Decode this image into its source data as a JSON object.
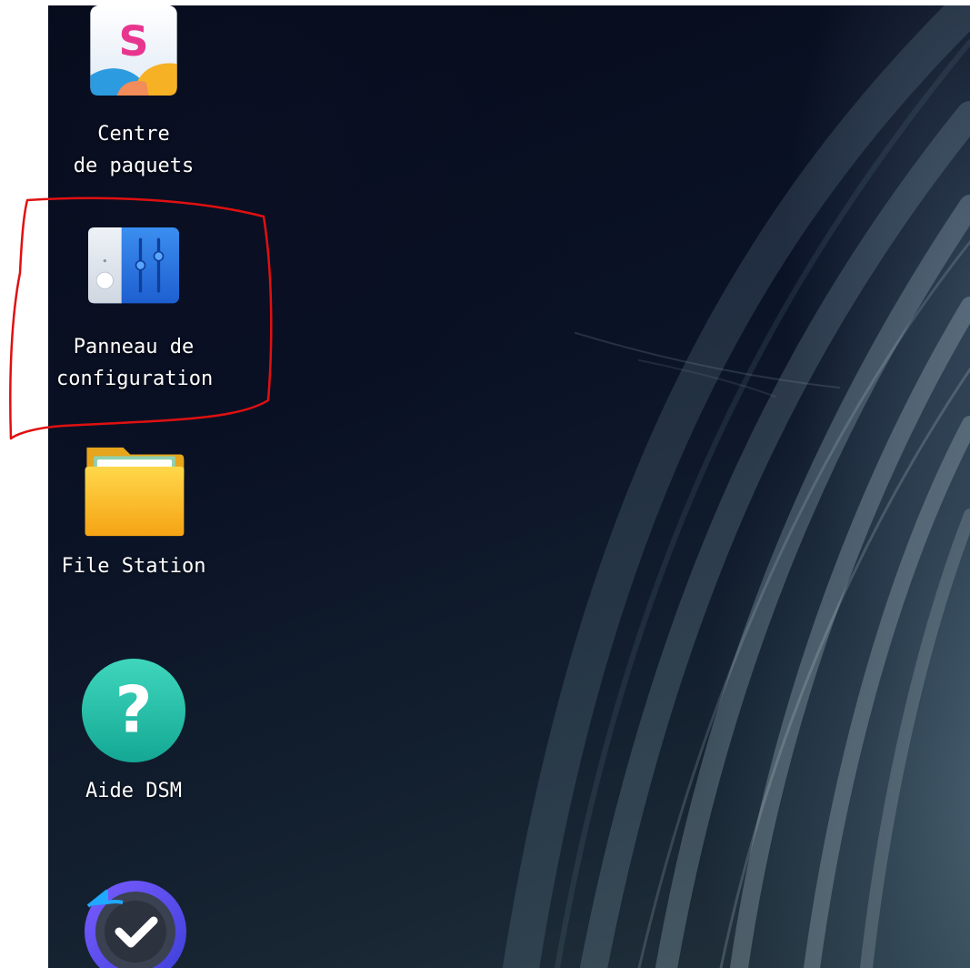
{
  "desktop": {
    "icons": [
      {
        "label": "Centre\nde paquets",
        "icon": "package-center-icon"
      },
      {
        "label": "Panneau de\nconfiguration",
        "icon": "control-panel-icon",
        "highlighted": true
      },
      {
        "label": "File Station",
        "icon": "file-station-folder-icon"
      },
      {
        "label": "Aide DSM",
        "icon": "help-question-icon"
      },
      {
        "label": "",
        "icon": "backup-check-icon"
      }
    ],
    "highlight_color": "#e01010"
  }
}
